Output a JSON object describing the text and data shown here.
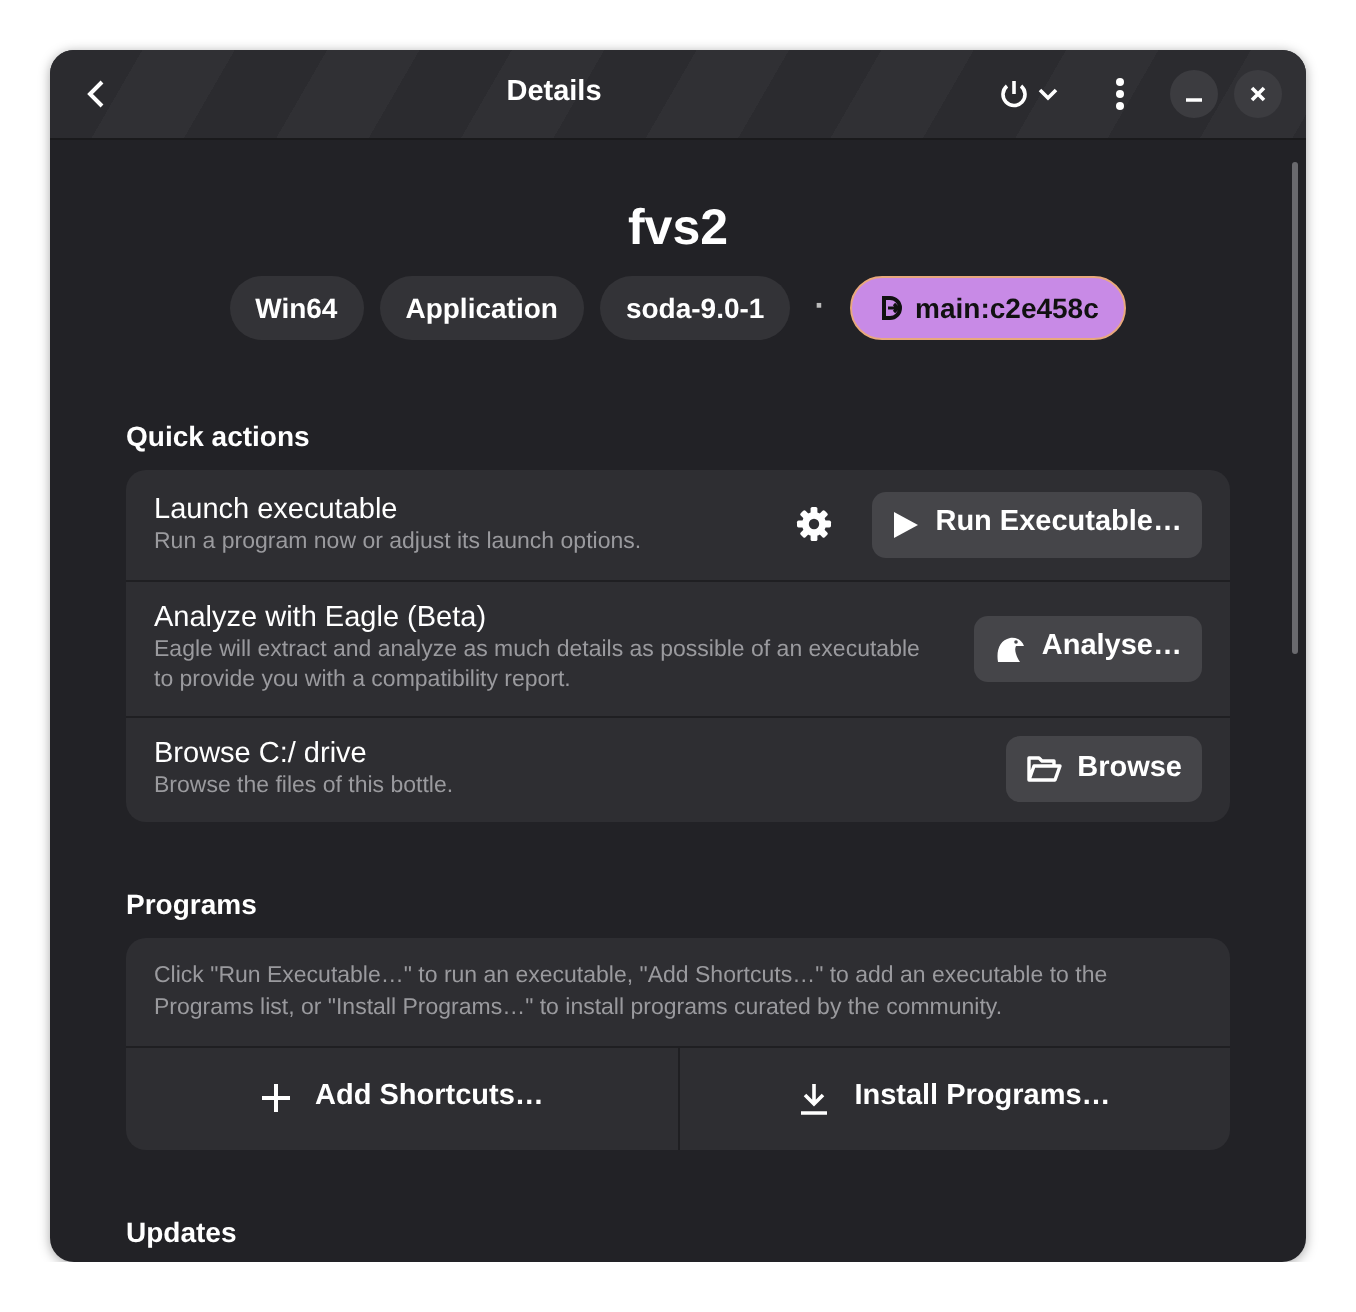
{
  "header": {
    "title": "Details"
  },
  "bottle": {
    "name": "fvs2",
    "tags": [
      {
        "kind": "tag",
        "label": "Win64"
      },
      {
        "kind": "tag",
        "label": "Application"
      },
      {
        "kind": "tag",
        "label": "soda-9.0-1"
      },
      {
        "kind": "separator",
        "label": "·"
      },
      {
        "kind": "branch",
        "label": "main:c2e458c"
      }
    ]
  },
  "quick_actions": {
    "heading": "Quick actions",
    "rows": [
      {
        "kind": "launch",
        "title": "Launch executable",
        "subtitle": "Run a program now or adjust its launch options.",
        "button": "Run Executable…"
      },
      {
        "kind": "analyze",
        "title": "Analyze with Eagle (Beta)",
        "subtitle": "Eagle will extract and analyze as much details as possible of an executable to provide you with a compatibility report.",
        "button": "Analyse…"
      },
      {
        "kind": "browse",
        "title": "Browse C:/ drive",
        "subtitle": "Browse the files of this bottle.",
        "button": "Browse"
      }
    ]
  },
  "programs": {
    "heading": "Programs",
    "description": "Click \"Run Executable…\" to run an executable, \"Add Shortcuts…\" to add an executable to the Programs list, or \"Install Programs…\" to install programs curated by the community.",
    "buttons": [
      {
        "kind": "add",
        "label": "Add Shortcuts…"
      },
      {
        "kind": "install",
        "label": "Install Programs…"
      }
    ]
  },
  "updates": {
    "heading": "Updates"
  }
}
